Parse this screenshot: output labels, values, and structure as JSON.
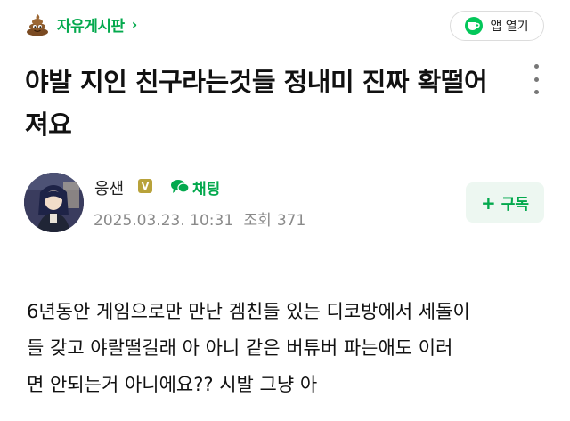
{
  "header": {
    "board_icon": "poop-emoji-icon",
    "board_name": "자유게시판",
    "board_chevron": "›",
    "app_open_label": "앱 열기",
    "app_open_icon": "naver-cafe-cup-icon"
  },
  "post": {
    "title": "야발 지인 친구라는것들 정내미 진짜 확떨어져요",
    "more_icon": "more-vertical-icon"
  },
  "author": {
    "name": "웅샌",
    "level_badge": "V",
    "chat_label": "채팅",
    "date": "2025.03.23. 10:31",
    "views_label": "조회",
    "views_count": "371",
    "subscribe_label": "구독",
    "subscribe_icon": "plus-icon"
  },
  "body": {
    "lines": [
      "6년동안 게임으로만 만난 겜친들 있는 디코방에서 세돌이",
      "들 갖고 야랄떨길래 아 아니 같은 버튜버 파는애도 이러",
      "면 안되는거 아니에요?? 시발 그냥 아"
    ]
  },
  "colors": {
    "accent_green": "#03a94d",
    "subscribe_bg": "#edf7f1",
    "meta_gray": "#8a8a8a"
  }
}
